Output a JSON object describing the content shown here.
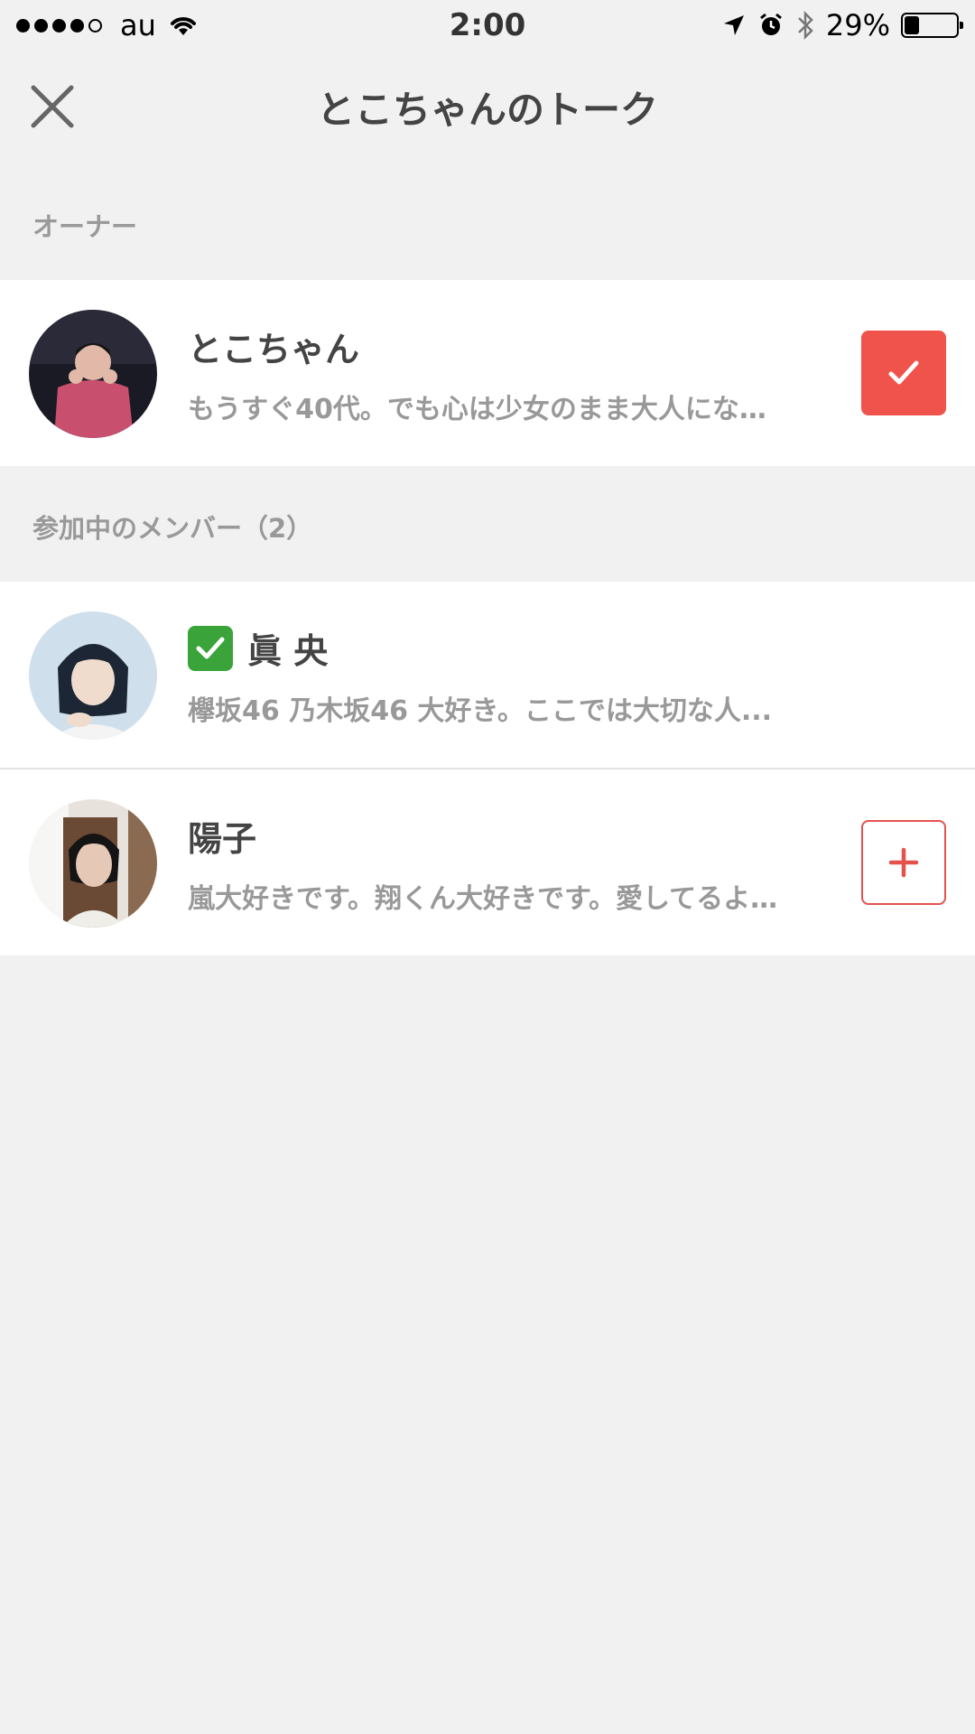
{
  "status_bar": {
    "carrier": "au",
    "time": "2:00",
    "battery_percent": "29%",
    "battery_level": 0.29,
    "signal_bars": 4,
    "signal_max": 5
  },
  "header": {
    "title": "とこちゃんのトーク",
    "close_icon": "close-icon"
  },
  "sections": {
    "owner_label": "オーナー",
    "members_label": "参加中のメンバー（2）"
  },
  "owner": {
    "name": "とこちゃん",
    "bio": "もうすぐ40代。でも心は少女のまま大人にな…",
    "status": "checked"
  },
  "members": [
    {
      "name": "眞 央",
      "bio": "欅坂46 乃木坂46 大好き。ここでは大切な人...",
      "verified": true
    },
    {
      "name": "陽子",
      "bio": "嵐大好きです。翔くん大好きです。愛してるよ…",
      "status": "add"
    }
  ],
  "colors": {
    "accent": "#f0524c",
    "background": "#f1f1f1",
    "verified": "#3aa43a"
  }
}
